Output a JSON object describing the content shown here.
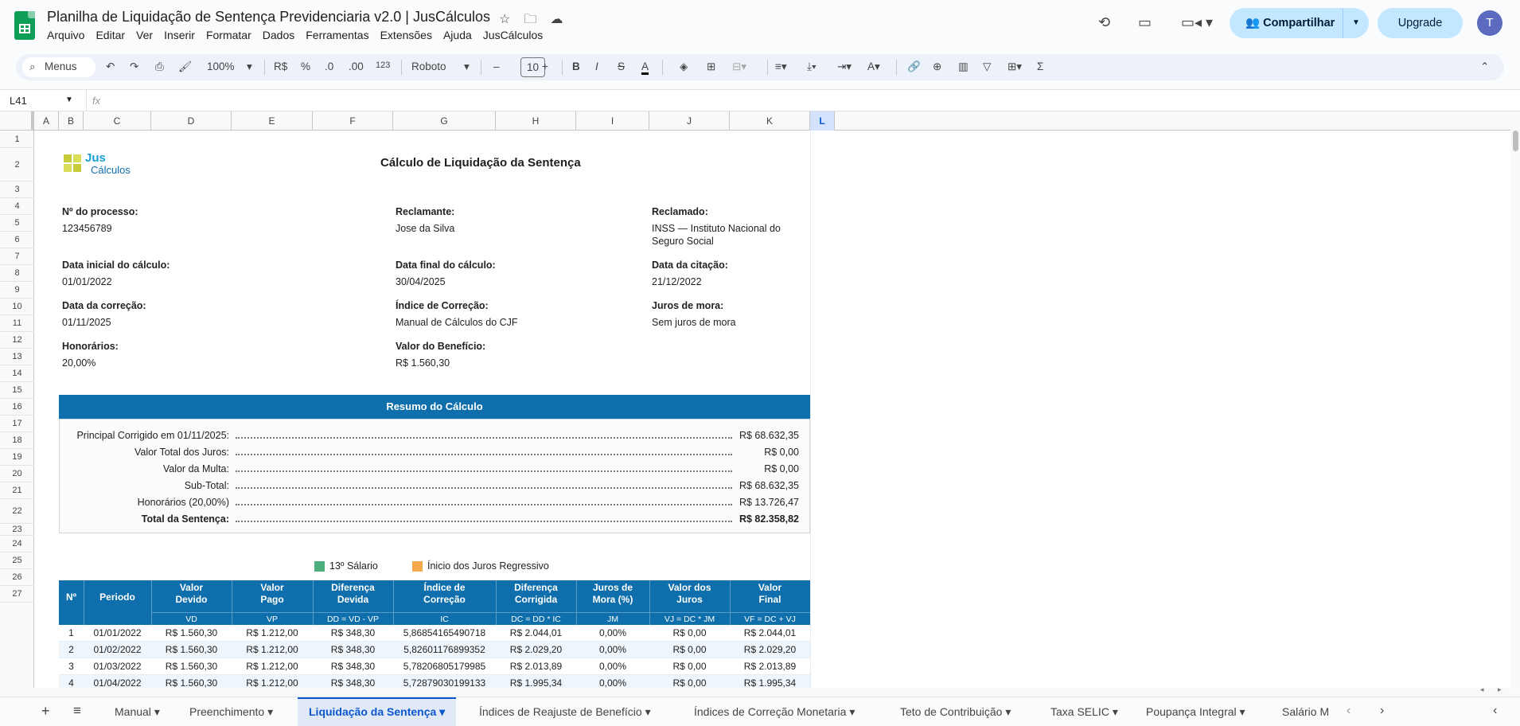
{
  "app": {
    "title": "Planilha de Liquidação de Sentença Previdenciaria v2.0 | JusCálculos"
  },
  "menu": [
    "Arquivo",
    "Editar",
    "Ver",
    "Inserir",
    "Formatar",
    "Dados",
    "Ferramentas",
    "Extensões",
    "Ajuda",
    "JusCálculos"
  ],
  "header": {
    "share_label": "Compartilhar",
    "upgrade_label": "Upgrade",
    "avatar_letter": "T"
  },
  "toolbar": {
    "menus_label": "Menus",
    "zoom": "100%",
    "currency": "R$",
    "percent": "%",
    "dec_less": ".0",
    "dec_more": ".00",
    "number_format": "123",
    "font": "Roboto",
    "font_size": "10"
  },
  "formula": {
    "namebox": "L41",
    "fx": "fx"
  },
  "columns": [
    "A",
    "B",
    "C",
    "D",
    "E",
    "F",
    "G",
    "H",
    "I",
    "J",
    "K",
    "L"
  ],
  "rows": [
    "1",
    "2",
    "3",
    "4",
    "5",
    "6",
    "7",
    "8",
    "9",
    "10",
    "11",
    "12",
    "13",
    "14",
    "15",
    "16",
    "17",
    "18",
    "19",
    "20",
    "21",
    "22",
    "23",
    "24",
    "25",
    "26",
    "27"
  ],
  "sheet": {
    "logo_top": "Jus",
    "logo_bottom": "Cálculos",
    "title": "Cálculo de Liquidação da Sentença",
    "processo_label": "Nº do processo:",
    "processo": "123456789",
    "reclamante_label": "Reclamante:",
    "reclamante": "Jose da Silva",
    "reclamado_label": "Reclamado:",
    "reclamado_1": "INSS — Instituto Nacional do",
    "reclamado_2": "Seguro Social",
    "data_inicial_label": "Data inicial do cálculo:",
    "data_inicial": "01/01/2022",
    "data_final_label": "Data final do cálculo:",
    "data_final": "30/04/2025",
    "data_citacao_label": "Data da citação:",
    "data_citacao": "21/12/2022",
    "data_correcao_label": "Data da correção:",
    "data_correcao": "01/11/2025",
    "indice_label": "Índice de Correção:",
    "indice": "Manual de Cálculos do CJF",
    "juros_label": "Juros de mora:",
    "juros": "Sem juros de mora",
    "honorarios_label": "Honorários:",
    "honorarios": "20,00%",
    "valor_beneficio_label": "Valor do Benefício:",
    "valor_beneficio": "R$ 1.560,30",
    "resumo_title": "Resumo do Cálculo",
    "resumo": [
      {
        "label": "Principal Corrigido em 01/11/2025:",
        "value": "R$ 68.632,35"
      },
      {
        "label": "Valor Total dos Juros:",
        "value": "R$ 0,00"
      },
      {
        "label": "Valor da Multa:",
        "value": "R$ 0,00"
      },
      {
        "label": "Sub-Total:",
        "value": "R$ 68.632,35"
      },
      {
        "label": "Honorários (20,00%)",
        "value": "R$ 13.726,47"
      },
      {
        "label": "Total da Sentença:",
        "value": "R$ 82.358,82"
      }
    ],
    "legend_1": "13º Sálario",
    "legend_2": "Ínicio dos Juros Regressivo",
    "table_headers": [
      [
        "Nº",
        ""
      ],
      [
        "Periodo",
        ""
      ],
      [
        "Valor\nDevido",
        "VD"
      ],
      [
        "Valor\nPago",
        "VP"
      ],
      [
        "Diferença\nDevida",
        "DD = VD - VP"
      ],
      [
        "Índice de\nCorreção",
        "IC"
      ],
      [
        "Diferença\nCorrigida",
        "DC = DD * IC"
      ],
      [
        "Juros de\nMora (%)",
        "JM"
      ],
      [
        "Valor dos\nJuros",
        "VJ = DC * JM"
      ],
      [
        "Valor\nFinal",
        "VF = DC + VJ"
      ]
    ],
    "table_rows": [
      [
        "1",
        "01/01/2022",
        "R$ 1.560,30",
        "R$ 1.212,00",
        "R$ 348,30",
        "5,86854165490718",
        "R$ 2.044,01",
        "0,00%",
        "R$ 0,00",
        "R$ 2.044,01"
      ],
      [
        "2",
        "01/02/2022",
        "R$ 1.560,30",
        "R$ 1.212,00",
        "R$ 348,30",
        "5,82601176899352",
        "R$ 2.029,20",
        "0,00%",
        "R$ 0,00",
        "R$ 2.029,20"
      ],
      [
        "3",
        "01/03/2022",
        "R$ 1.560,30",
        "R$ 1.212,00",
        "R$ 348,30",
        "5,78206805179985",
        "R$ 2.013,89",
        "0,00%",
        "R$ 0,00",
        "R$ 2.013,89"
      ],
      [
        "4",
        "01/04/2022",
        "R$ 1.560,30",
        "R$ 1.212,00",
        "R$ 348,30",
        "5,72879030199133",
        "R$ 1.995,34",
        "0,00%",
        "R$ 0,00",
        "R$ 1.995,34"
      ]
    ]
  },
  "tabs": [
    "Manual",
    "Preenchimento",
    "Liquidação da Sentença",
    "Índices de Reajuste de Benefício",
    "Índices de Correção Monetaria",
    "Teto de Contribuição",
    "Taxa SELIC",
    "Poupança Integral",
    "Salário M"
  ],
  "colors": {
    "accent": "#0f6fad",
    "legend_green": "#4caf7d",
    "legend_orange": "#f4a94a"
  }
}
